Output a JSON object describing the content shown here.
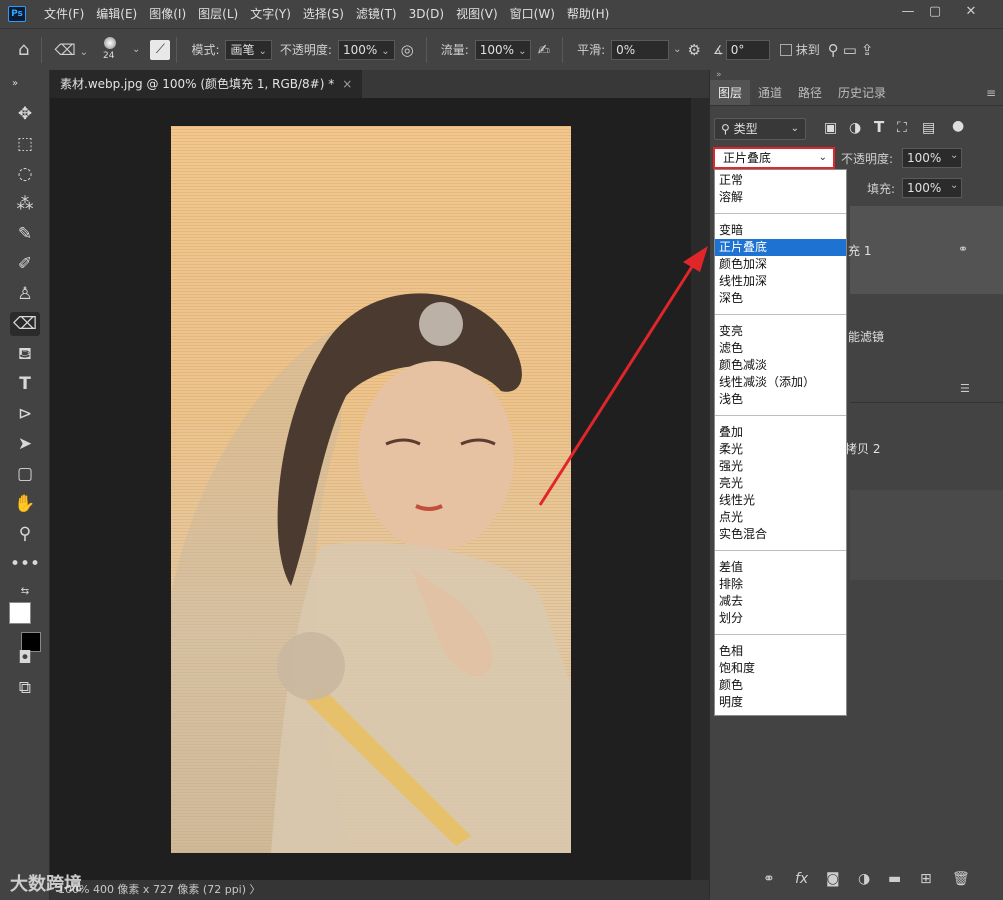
{
  "app": {
    "logo": "Ps",
    "menu": [
      "文件(F)",
      "编辑(E)",
      "图像(I)",
      "图层(L)",
      "文字(Y)",
      "选择(S)",
      "滤镜(T)",
      "3D(D)",
      "视图(V)",
      "窗口(W)",
      "帮助(H)"
    ],
    "window_controls": [
      "—",
      "▢",
      "✕"
    ]
  },
  "options": {
    "brush_size": "24",
    "mode_label": "模式:",
    "mode_value": "画笔",
    "opacity_label": "不透明度:",
    "opacity_value": "100%",
    "flow_label": "流量:",
    "flow_value": "100%",
    "smooth_label": "平滑:",
    "smooth_value": "0%",
    "angle_value": "0°",
    "erase_label": "抹到"
  },
  "document": {
    "tab_title": "素材.webp.jpg @ 100% (颜色填充 1, RGB/8#) *",
    "close": "×",
    "status": "100%     400 像素 x 727 像素 (72 ppi)  〉"
  },
  "layers_panel": {
    "tabs": [
      "图层",
      "通道",
      "路径",
      "历史记录"
    ],
    "filter_label": "类型",
    "opacity_label": "不透明度:",
    "opacity_value": "100%",
    "fill_label": "填充:",
    "fill_value": "100%",
    "blend_mode": "正片叠底",
    "layer1_partial": "充 1",
    "smart_filter_partial": "能滤镜",
    "layer3_partial": "拷贝 2"
  },
  "blend_groups": [
    [
      "正常",
      "溶解"
    ],
    [
      "变暗",
      "正片叠底",
      "颜色加深",
      "线性加深",
      "深色"
    ],
    [
      "变亮",
      "滤色",
      "颜色减淡",
      "线性减淡（添加）",
      "浅色"
    ],
    [
      "叠加",
      "柔光",
      "强光",
      "亮光",
      "线性光",
      "点光",
      "实色混合"
    ],
    [
      "差值",
      "排除",
      "减去",
      "划分"
    ],
    [
      "色相",
      "饱和度",
      "颜色",
      "明度"
    ]
  ],
  "selected_blend": "正片叠底",
  "watermark": "大数跨境",
  "colors": {
    "highlight": "#1e73d2",
    "annotation": "#e0262b"
  }
}
